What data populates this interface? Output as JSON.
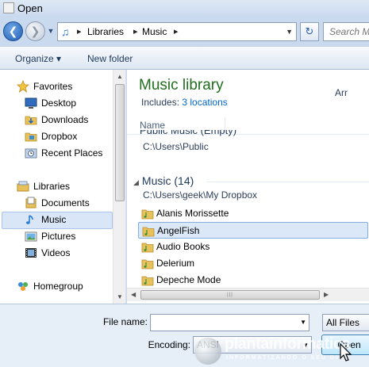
{
  "window": {
    "title": "Open"
  },
  "address": {
    "crumbs": [
      "Libraries",
      "Music"
    ],
    "search_placeholder": "Search Mu"
  },
  "toolbar": {
    "organize_label": "Organize ▾",
    "new_folder_label": "New folder"
  },
  "nav": {
    "items": [
      {
        "label": "Favorites",
        "icon": "star-icon"
      },
      {
        "label": "Desktop",
        "icon": "desktop-icon"
      },
      {
        "label": "Downloads",
        "icon": "downloads-folder-icon"
      },
      {
        "label": "Dropbox",
        "icon": "dropbox-folder-icon"
      },
      {
        "label": "Recent Places",
        "icon": "recent-places-icon"
      },
      {
        "label": "Libraries",
        "icon": "libraries-icon"
      },
      {
        "label": "Documents",
        "icon": "documents-icon"
      },
      {
        "label": "Music",
        "icon": "music-icon"
      },
      {
        "label": "Pictures",
        "icon": "pictures-icon"
      },
      {
        "label": "Videos",
        "icon": "videos-icon"
      },
      {
        "label": "Homegroup",
        "icon": "homegroup-icon"
      }
    ],
    "selected": "Music"
  },
  "content": {
    "library_title": "Music library",
    "includes_prefix": "Includes: ",
    "includes_link": "3 locations",
    "arrange_label": "Arr",
    "column_name": "Name",
    "group_public_partial": "Public Music (Empty)",
    "public_path": "C:\\Users\\Public",
    "group_music_title": "Music (14)",
    "music_path": "C:\\Users\\geek\\My Dropbox",
    "files": [
      "Alanis Morissette",
      "AngelFish",
      "Audio Books",
      "Delerium",
      "Depeche Mode"
    ],
    "selected_file": "AngelFish"
  },
  "bottom": {
    "file_name_label": "File name:",
    "file_name_value": "",
    "file_type_value": "All Files",
    "encoding_label": "Encoding:",
    "encoding_value": "ANSI",
    "open_button_label": "Open"
  },
  "watermark": {
    "brand": "plantainformatica",
    "tagline": "INFORMATIZANDO O SEU DIA"
  },
  "colors": {
    "library_title": "#1e6e1e",
    "link": "#0066cc",
    "selection": "#dbe8f8",
    "accent": "#1f5fb4"
  }
}
